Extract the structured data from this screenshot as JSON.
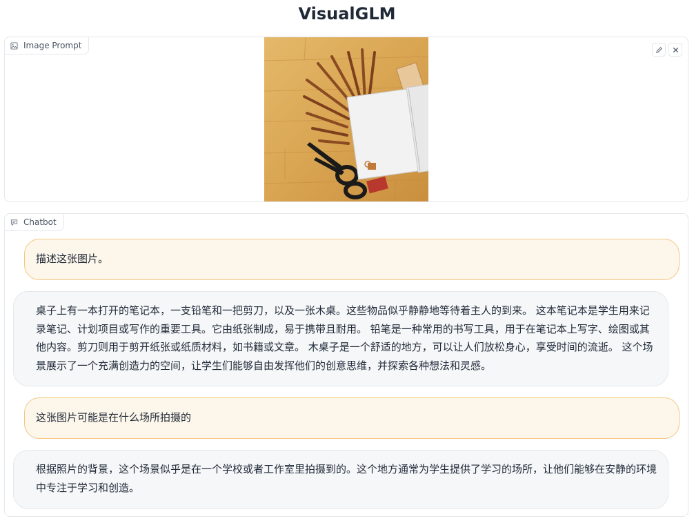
{
  "app": {
    "title": "VisualGLM"
  },
  "image_panel": {
    "label": "Image Prompt",
    "label_icon": "image-icon",
    "edit_icon": "pencil-icon",
    "clear_icon": "close-icon"
  },
  "chat_panel": {
    "label": "Chatbot",
    "label_icon": "chat-bubble-icon",
    "messages": [
      {
        "role": "user",
        "text": "描述这张图片。"
      },
      {
        "role": "bot",
        "text": "桌子上有一本打开的笔记本，一支铅笔和一把剪刀，以及一张木桌。这些物品似乎静静地等待着主人的到来。 这本笔记本是学生用来记录笔记、计划项目或写作的重要工具。它由纸张制成，易于携带且耐用。 铅笔是一种常用的书写工具，用于在笔记本上写字、绘图或其他内容。剪刀则用于剪开纸张或纸质材料，如书籍或文章。 木桌子是一个舒适的地方，可以让人们放松身心，享受时间的流逝。 这个场景展示了一个充满创造力的空间，让学生们能够自由发挥他们的创意思维，并探索各种想法和灵感。"
      },
      {
        "role": "user",
        "text": "这张图片可能是在什么场所拍摄的"
      },
      {
        "role": "bot",
        "text": "根据照片的背景，这个场景似乎是在一个学校或者工作室里拍摄到的。这个地方通常为学生提供了学习的场所，让他们能够在安静的环境中专注于学习和创造。"
      }
    ]
  },
  "colors": {
    "user_bubble_bg": "#fdf6ea",
    "user_bubble_border": "#f3c77f",
    "bot_bubble_bg": "#f6f7f9",
    "wood": "#d9a95a"
  }
}
